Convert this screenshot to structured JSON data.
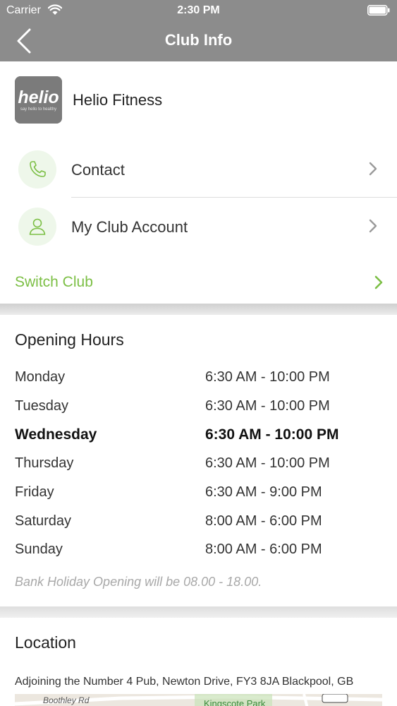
{
  "status_bar": {
    "carrier": "Carrier",
    "time": "2:30 PM"
  },
  "nav": {
    "title": "Club Info"
  },
  "club": {
    "name": "Helio Fitness",
    "logo_text": "helio",
    "logo_tagline": "say hello to healthy"
  },
  "menu": [
    {
      "label": "Contact",
      "icon": "phone-icon"
    },
    {
      "label": "My Club Account",
      "icon": "user-icon"
    }
  ],
  "switch_club": {
    "label": "Switch Club"
  },
  "opening_hours": {
    "title": "Opening Hours",
    "days": [
      {
        "day": "Monday",
        "hours": "6:30 AM - 10:00 PM"
      },
      {
        "day": "Tuesday",
        "hours": "6:30 AM - 10:00 PM"
      },
      {
        "day": "Wednesday",
        "hours": "6:30 AM - 10:00 PM"
      },
      {
        "day": "Thursday",
        "hours": "6:30 AM - 10:00 PM"
      },
      {
        "day": "Friday",
        "hours": "6:30 AM - 9:00 PM"
      },
      {
        "day": "Saturday",
        "hours": "8:00 AM - 6:00 PM"
      },
      {
        "day": "Sunday",
        "hours": "8:00 AM - 6:00 PM"
      }
    ],
    "today": "Wednesday",
    "note": "Bank Holiday Opening will be 08.00 - 18.00."
  },
  "location": {
    "title": "Location",
    "address": "Adjoining the Number 4 Pub, Newton Drive, FY3 8JA Blackpool, GB",
    "map": {
      "road_label": "Boothley Rd",
      "park_label": "Kingscote Park"
    }
  },
  "colors": {
    "header": "#8c8c8c",
    "accent_green": "#7cbf45",
    "icon_circle": "#eef7ea"
  }
}
